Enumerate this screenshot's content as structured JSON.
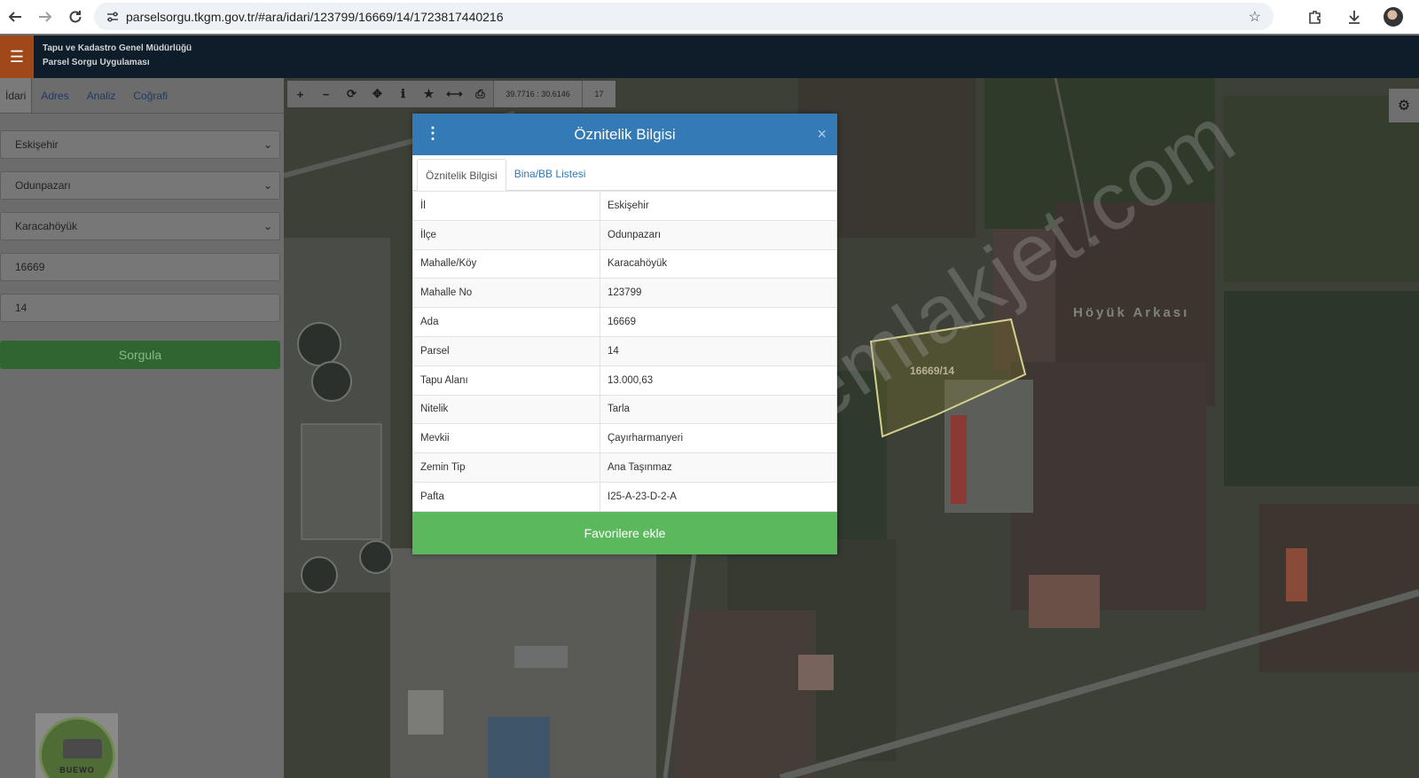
{
  "browser": {
    "url": "parselsorgu.tkgm.gov.tr/#ara/idari/123799/16669/14/1723817440216"
  },
  "header": {
    "org_line1": "Tapu ve Kadastro Genel Müdürlüğü",
    "org_line2": "Parsel Sorgu Uygulaması"
  },
  "sidebar": {
    "tabs": [
      "İdari",
      "Adres",
      "Analiz",
      "Coğrafi"
    ],
    "province": "Eskişehir",
    "district": "Odunpazarı",
    "neighborhood": "Karacahöyük",
    "block": "16669",
    "parcel": "14",
    "query_label": "Sorgula",
    "logo_text": "BUEWO"
  },
  "map": {
    "coords": "39.7716 : 30.6146",
    "zoom": "17",
    "place_label": "Höyük Arkası",
    "parcel_label": "16669/14",
    "watermark": "emlakjet.com"
  },
  "modal": {
    "title": "Öznitelik Bilgisi",
    "tabs": [
      "Öznitelik Bilgisi",
      "Bina/BB Listesi"
    ],
    "rows": [
      {
        "k": "İl",
        "v": "Eskişehir"
      },
      {
        "k": "İlçe",
        "v": "Odunpazarı"
      },
      {
        "k": "Mahalle/Köy",
        "v": "Karacahöyük"
      },
      {
        "k": "Mahalle No",
        "v": "123799"
      },
      {
        "k": "Ada",
        "v": "16669"
      },
      {
        "k": "Parsel",
        "v": "14"
      },
      {
        "k": "Tapu Alanı",
        "v": "13.000,63"
      },
      {
        "k": "Nitelik",
        "v": "Tarla"
      },
      {
        "k": "Mevkii",
        "v": "Çayırharmanyeri"
      },
      {
        "k": "Zemin Tip",
        "v": "Ana Taşınmaz"
      },
      {
        "k": "Pafta",
        "v": "I25-A-23-D-2-A"
      }
    ],
    "favorite_label": "Favorilere ekle"
  },
  "colors": {
    "modal_header": "#337ab7",
    "favorite_button": "#5cb85c",
    "app_header": "#0f1d2a",
    "hamburger": "#a0481a"
  }
}
